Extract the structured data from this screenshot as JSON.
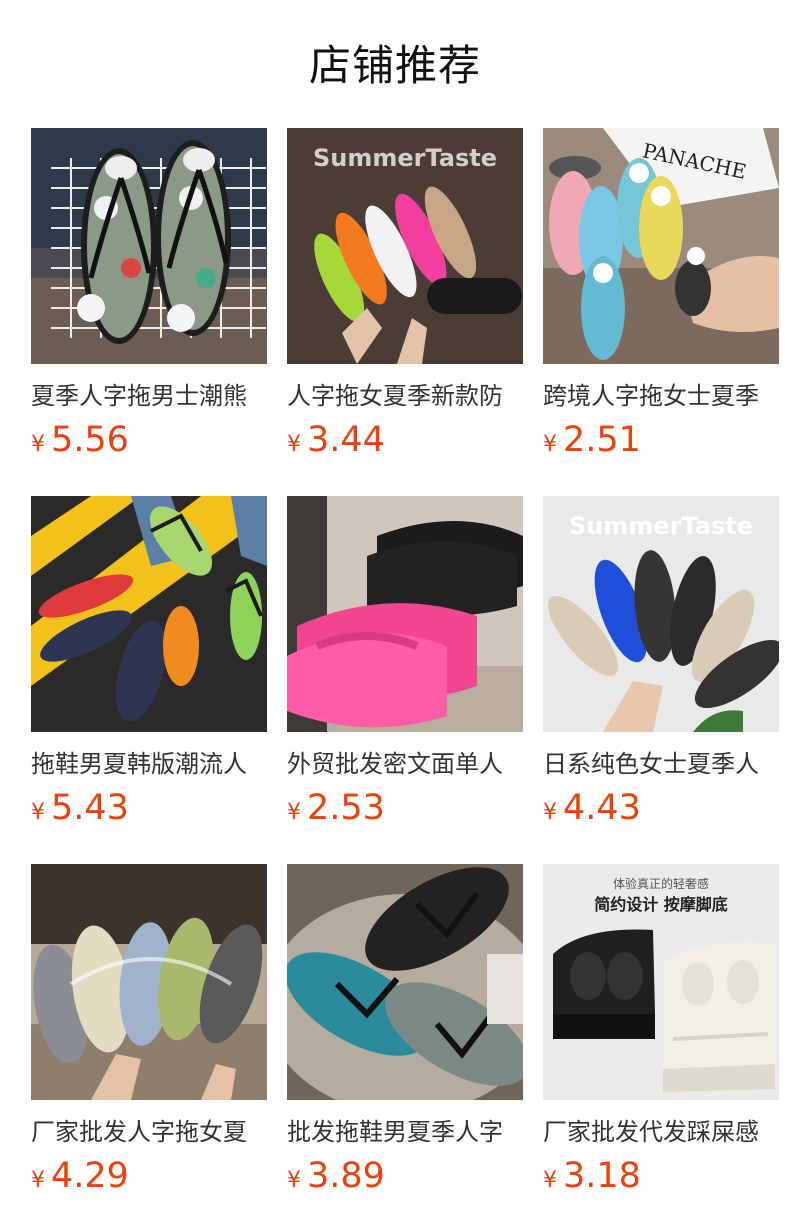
{
  "section": {
    "title": "店铺推荐"
  },
  "currency": "¥",
  "products": [
    {
      "name": "夏季人字拖男士潮熊",
      "price": "5.56",
      "watermark": ""
    },
    {
      "name": "人字拖女夏季新款防",
      "price": "3.44",
      "watermark": "SummerTaste"
    },
    {
      "name": "跨境人字拖女士夏季",
      "price": "2.51",
      "watermark": "PANACHE"
    },
    {
      "name": "拖鞋男夏韩版潮流人",
      "price": "5.43",
      "watermark": ""
    },
    {
      "name": "外贸批发密文面单人",
      "price": "2.53",
      "watermark": ""
    },
    {
      "name": "日系纯色女士夏季人",
      "price": "4.43",
      "watermark": "SummerTaste"
    },
    {
      "name": "厂家批发人字拖女夏",
      "price": "4.29",
      "watermark": ""
    },
    {
      "name": "批发拖鞋男夏季人字",
      "price": "3.89",
      "watermark": ""
    },
    {
      "name": "厂家批发代发踩屎感",
      "price": "3.18",
      "watermark": ""
    }
  ],
  "product9_overlay": {
    "line1": "体验真正的轻奢感",
    "line2": "简约设计 按摩脚底"
  },
  "colors": {
    "price": "#e8420d",
    "title": "#111111"
  }
}
